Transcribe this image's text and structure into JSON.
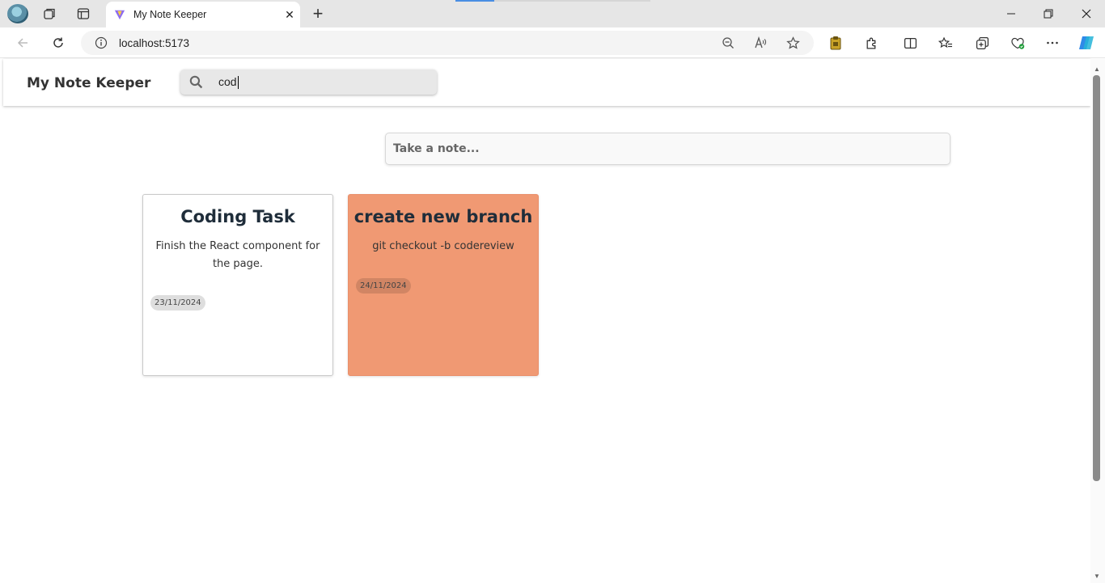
{
  "browser": {
    "tab_title": "My Note Keeper",
    "url": "localhost:5173"
  },
  "app": {
    "title": "My Note Keeper",
    "search_value": "cod",
    "take_note_placeholder": "Take a note..."
  },
  "notes": [
    {
      "title": "Coding Task",
      "body": "Finish the React component for the page.",
      "date": "23/11/2024",
      "color": "#ffffff"
    },
    {
      "title": "create new branch",
      "body": "git checkout -b codereview",
      "date": "24/11/2024",
      "color": "#f09973"
    }
  ],
  "colors": {
    "page_bg": "#ffffff",
    "search_bg": "#e8e8e8",
    "load_bar": "#4a8ee3"
  }
}
